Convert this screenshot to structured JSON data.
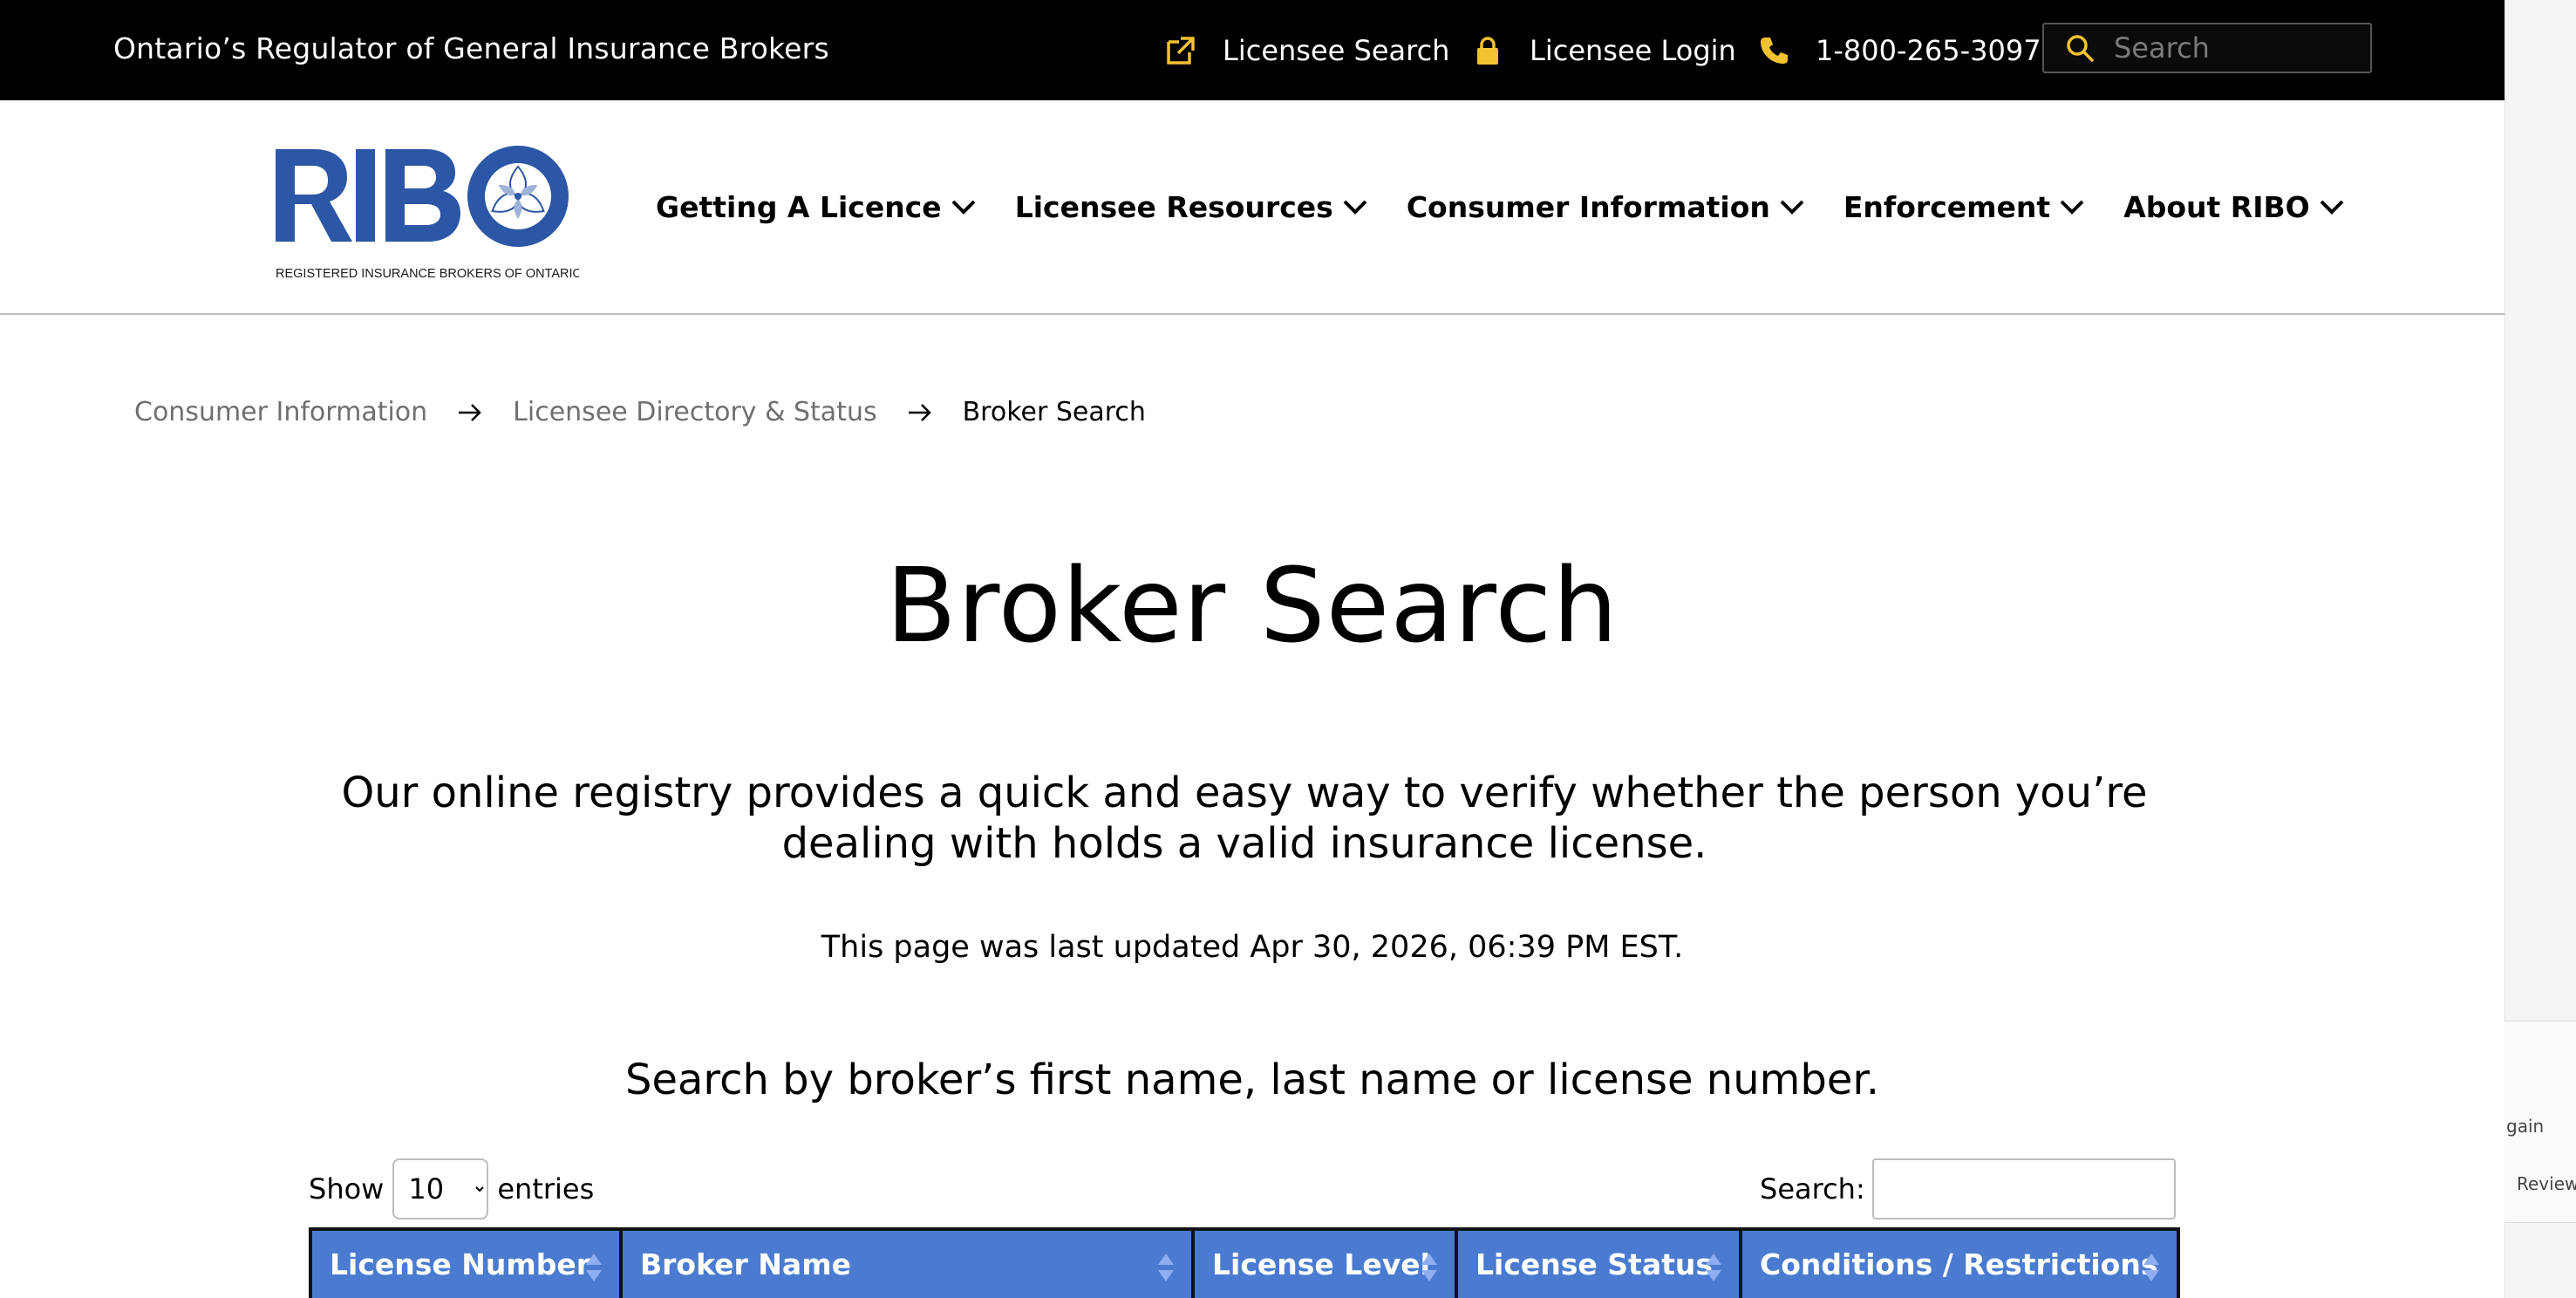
{
  "topbar": {
    "tagline": "Ontario’s Regulator of General Insurance Brokers",
    "links": [
      {
        "label": "Licensee Search",
        "icon": "external-link-icon"
      },
      {
        "label": "Licensee Login",
        "icon": "lock-icon"
      },
      {
        "label": "1-800-265-3097",
        "icon": "phone-icon"
      }
    ],
    "search_placeholder": "Search",
    "accent_color": "#f2c230"
  },
  "logo": {
    "text": "RIBO",
    "subtitle": "REGISTERED INSURANCE BROKERS OF ONTARIO",
    "color": "#2c56a6"
  },
  "nav": {
    "items": [
      {
        "label": "Getting A Licence"
      },
      {
        "label": "Licensee Resources"
      },
      {
        "label": "Consumer Information"
      },
      {
        "label": "Enforcement"
      },
      {
        "label": "About RIBO"
      }
    ]
  },
  "breadcrumb": {
    "items": [
      "Consumer Information",
      "Licensee Directory & Status",
      "Broker Search"
    ]
  },
  "main": {
    "title": "Broker Search",
    "intro": "Our online registry provides a quick and easy way to verify whether the person you’re dealing with holds a valid insurance license.",
    "updated": "This page was last updated Apr 30, 2026, 06:39 PM EST.",
    "search_hint": "Search by broker’s first name, last name or license number."
  },
  "table_controls": {
    "show_label": "Show",
    "entries_selected": "10",
    "entries_label": "entries",
    "search_label": "Search:"
  },
  "table": {
    "header_color": "#4a7bd0",
    "columns": [
      "License Number",
      "Broker Name",
      "License Level",
      "License Status",
      "Conditions / Restrictions"
    ]
  },
  "side_panel": {
    "items": [
      "gain",
      "Review"
    ]
  }
}
